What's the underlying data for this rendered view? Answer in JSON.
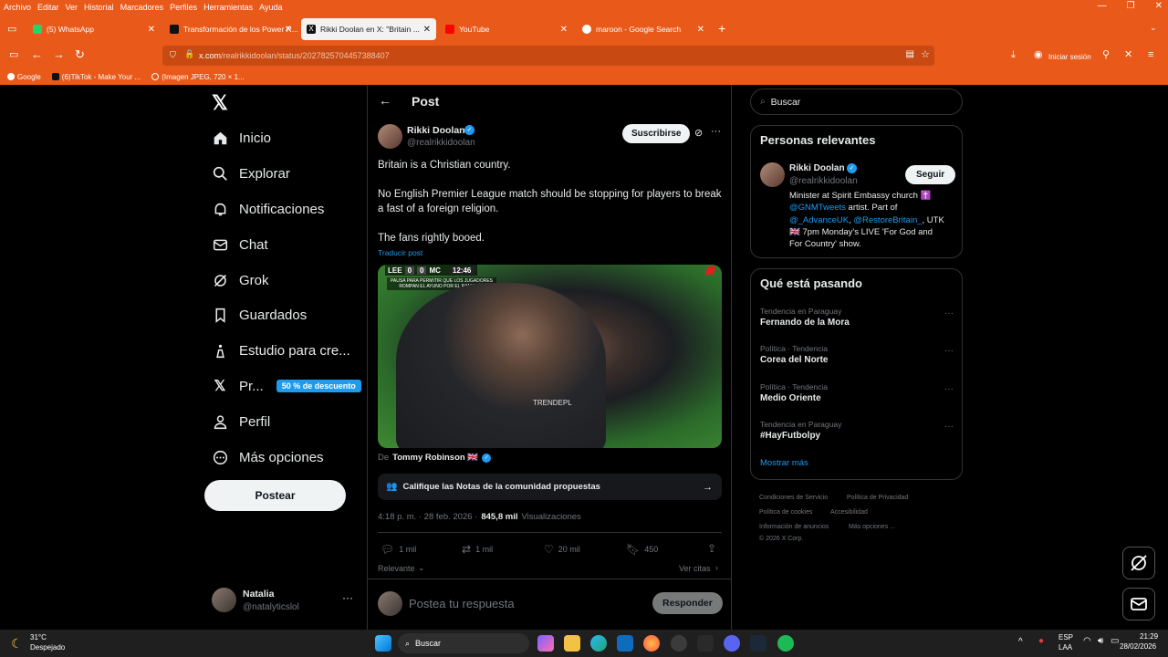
{
  "menubar": [
    "Archivo",
    "Editar",
    "Ver",
    "Historial",
    "Marcadores",
    "Perfiles",
    "Herramientas",
    "Ayuda"
  ],
  "tabs": [
    {
      "label": "(5) WhatsApp",
      "color": "#25d366"
    },
    {
      "label": "Transformación de los Power R...",
      "color": "#111111"
    },
    {
      "label": "Rikki Doolan en X: \"Britain ...",
      "color": "#111111"
    },
    {
      "label": "YouTube",
      "color": "#ff0000"
    },
    {
      "label": "maroon - Google Search",
      "color": "#ffffff"
    }
  ],
  "url": {
    "host": "x.com",
    "path": "/realrikkidoolan/status/2027825704457388407"
  },
  "browser": {
    "signin": "Iniciar sesión"
  },
  "bookmarks": [
    "Google",
    "(6)TikTok - Make Your ...",
    "(Imagen JPEG, 720 × 1..."
  ],
  "nav": {
    "items": [
      "Inicio",
      "Explorar",
      "Notificaciones",
      "Chat",
      "Grok",
      "Guardados",
      "Estudio para cre...",
      "Pr...",
      "Perfil",
      "Más opciones"
    ],
    "promo": "50 % de descuento",
    "post_button": "Postear"
  },
  "account": {
    "name": "Natalia",
    "handle": "@natalyticslol"
  },
  "post": {
    "header": "Post",
    "author": "Rikki Doolan",
    "handle": "@realrikkidoolan",
    "subscribe": "Suscribirse",
    "paragraphs": [
      "Britain is a Christian country.",
      "No English Premier League match should be stopping for players to break a fast of a foreign religion.",
      "The fans rightly booed."
    ],
    "translate": "Traducir post",
    "media": {
      "home": "LEE",
      "score_home": "0",
      "score_away": "0",
      "away": "MC",
      "clock": "12:46",
      "caption": "PAUSA PARA PERMITIR QUE LOS JUGADORES ROMPAN EL AYUNO POR EL RAMADÁN",
      "watermark": "TRENDEPL"
    },
    "from_prefix": "De",
    "from_name": "Tommy Robinson 🇬🇧",
    "notes": "Califique las Notas de la comunidad propuestas",
    "time": "4:18 p. m. · 28 feb. 2026 ·",
    "views_count": "845,8 mil",
    "views_label": "Visualizaciones",
    "replies": "1 mil",
    "reposts": "1 mil",
    "likes": "20 mil",
    "bookmarks": "450",
    "relevant": "Relevante",
    "quotes": "Ver citas",
    "reply_placeholder": "Postea tu respuesta",
    "reply_button": "Responder"
  },
  "right": {
    "search_placeholder": "Buscar",
    "people_title": "Personas relevantes",
    "person": {
      "name": "Rikki Doolan",
      "handle": "@realrikkidoolan",
      "follow": "Seguir",
      "bio_1": "Minister at Spirit Embassy church ✝️",
      "bio_2_link": "@GNMTweets",
      "bio_2_rest": " artist. Part of",
      "bio_3_link1": "@_AdvanceUK",
      "bio_3_sep": ", ",
      "bio_3_link2": "@RestoreBritain_",
      "bio_3_rest": ", UTK",
      "bio_4": "🇬🇧 7pm Monday's LIVE 'For God and",
      "bio_5": "For Country' show."
    },
    "trends_title": "Qué está pasando",
    "trends": [
      {
        "context": "Tendencia en Paraguay",
        "title": "Fernando de la Mora"
      },
      {
        "context": "Política · Tendencia",
        "title": "Corea del Norte"
      },
      {
        "context": "Política · Tendencia",
        "title": "Medio Oriente"
      },
      {
        "context": "Tendencia en Paraguay",
        "title": "#HayFutbolpy"
      }
    ],
    "show_more": "Mostrar más",
    "footer": [
      "Condiciones de Servicio",
      "Política de Privacidad",
      "Política de cookies",
      "Accesibilidad",
      "Información de anuncios",
      "Más opciones ...",
      "© 2026 X Corp."
    ]
  },
  "taskbar": {
    "temp": "31°C",
    "weather": "Despejado",
    "search": "Buscar",
    "lang1": "ESP",
    "lang2": "LAA",
    "time": "21:29",
    "date": "28/02/2026"
  },
  "colors": {
    "accent": "#1d9bf0",
    "firefox_orange": "#e8591a"
  }
}
